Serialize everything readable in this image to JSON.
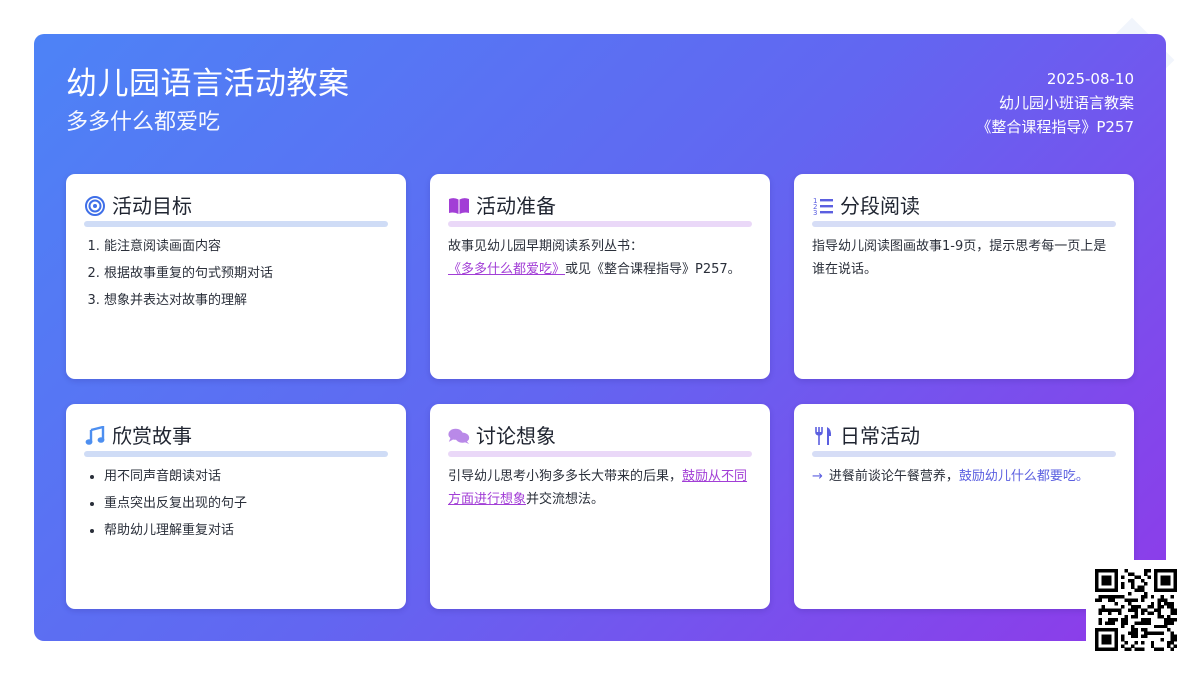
{
  "header": {
    "title": "幼儿园语言活动教案",
    "subtitle": "多多什么都爱吃"
  },
  "meta": {
    "date": "2025-08-10",
    "category": "幼儿园小班语言教案",
    "source": "《整合课程指导》P257"
  },
  "cards": {
    "goals": {
      "title": "活动目标",
      "icon": "target-icon",
      "items": [
        "能注意阅读画面内容",
        "根据故事重复的句式预期对话",
        "想象并表达对故事的理解"
      ]
    },
    "preparation": {
      "title": "活动准备",
      "icon": "book-open-icon",
      "text_before": "故事见幼儿园早期阅读系列丛书：",
      "link": "《多多什么都爱吃》",
      "text_after": "或见《整合课程指导》P257。"
    },
    "reading": {
      "title": "分段阅读",
      "icon": "numbered-list-icon",
      "text": "指导幼儿阅读图画故事1-9页，提示思考每一页上是谁在说话。"
    },
    "appreciation": {
      "title": "欣赏故事",
      "icon": "music-note-icon",
      "items": [
        "用不同声音朗读对话",
        "重点突出反复出现的句子",
        "帮助幼儿理解重复对话"
      ]
    },
    "discussion": {
      "title": "讨论想象",
      "icon": "chat-bubbles-icon",
      "text_before": "引导幼儿思考小狗多多长大带来的后果，",
      "link": "鼓励从不同方面进行想象",
      "text_after": "并交流想法。"
    },
    "daily": {
      "title": "日常活动",
      "icon": "utensils-icon",
      "text_before": "进餐前谈论午餐营养，",
      "highlight": "鼓励幼儿什么都要吃。"
    }
  },
  "colors": {
    "gradient_start": "#4d83f6",
    "gradient_end": "#8f3ae9",
    "accent_blue": "#3f6fe8",
    "accent_purple": "#a23ed6",
    "accent_indigo": "#5b5fe0"
  }
}
